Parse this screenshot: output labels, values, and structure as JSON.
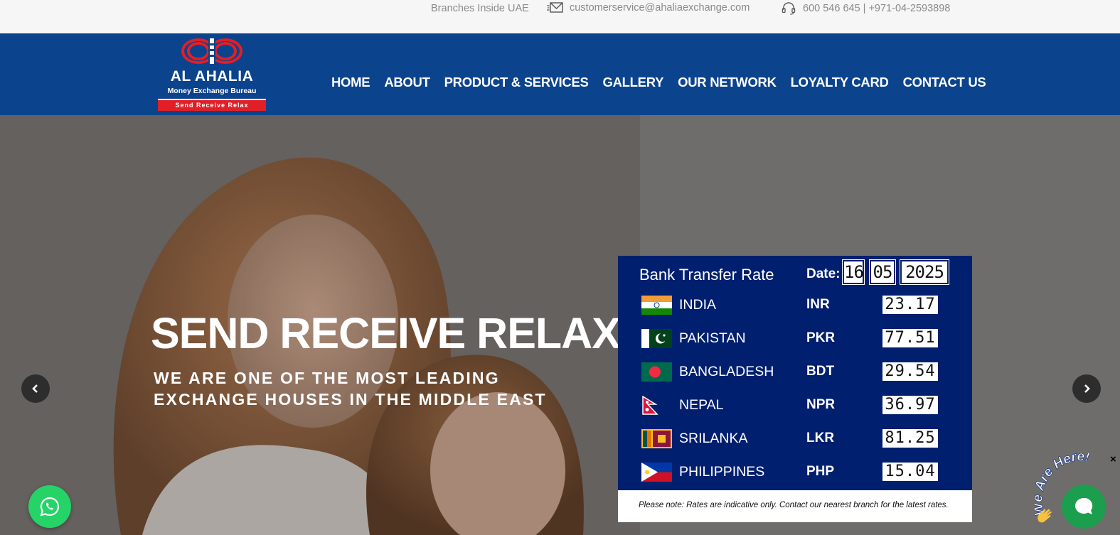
{
  "topbar": {
    "branches": "Branches Inside UAE",
    "email": "customerservice@ahaliaexchange.com",
    "phone": "600 546 645 | +971-04-2593898"
  },
  "logo": {
    "name": "AL AHALIA",
    "subtitle": "Money Exchange Bureau",
    "tagline": "Send Receive Relax"
  },
  "nav": [
    "HOME",
    "ABOUT",
    "PRODUCT & SERVICES",
    "GALLERY",
    "OUR NETWORK",
    "LOYALTY CARD",
    "CONTACT US"
  ],
  "hero": {
    "title": "SEND RECEIVE RELAX",
    "subtitle": "WE ARE ONE OF THE MOST LEADING EXCHANGE HOUSES IN THE MIDDLE EAST"
  },
  "rates": {
    "title": "Bank Transfer Rate",
    "date_label": "Date:",
    "date": {
      "day": "16",
      "month": "05",
      "year": "2025"
    },
    "rows": [
      {
        "country": "INDIA",
        "code": "INR",
        "rate": "23.17"
      },
      {
        "country": "PAKISTAN",
        "code": "PKR",
        "rate": "77.51"
      },
      {
        "country": "BANGLADESH",
        "code": "BDT",
        "rate": "29.54"
      },
      {
        "country": "NEPAL",
        "code": "NPR",
        "rate": "36.97"
      },
      {
        "country": "SRILANKA",
        "code": "LKR",
        "rate": "81.25"
      },
      {
        "country": "PHILIPPINES",
        "code": "PHP",
        "rate": "15.04"
      }
    ],
    "note": "Please note: Rates are indicative only. Contact our nearest branch for the latest rates."
  },
  "chat": {
    "label": "We Are Here!"
  },
  "icons": {
    "email": "envelope-icon",
    "phone": "headset-icon",
    "prev": "chevron-left-icon",
    "next": "chevron-right-icon",
    "whatsapp": "whatsapp-icon",
    "chat": "chat-bubble-icon"
  },
  "colors": {
    "nav_bg": "#0b438d",
    "rate_board_bg": "#001f6f",
    "brand_red": "#e11f26",
    "whatsapp_green": "#25d366",
    "chat_green": "#1b9e4d"
  }
}
